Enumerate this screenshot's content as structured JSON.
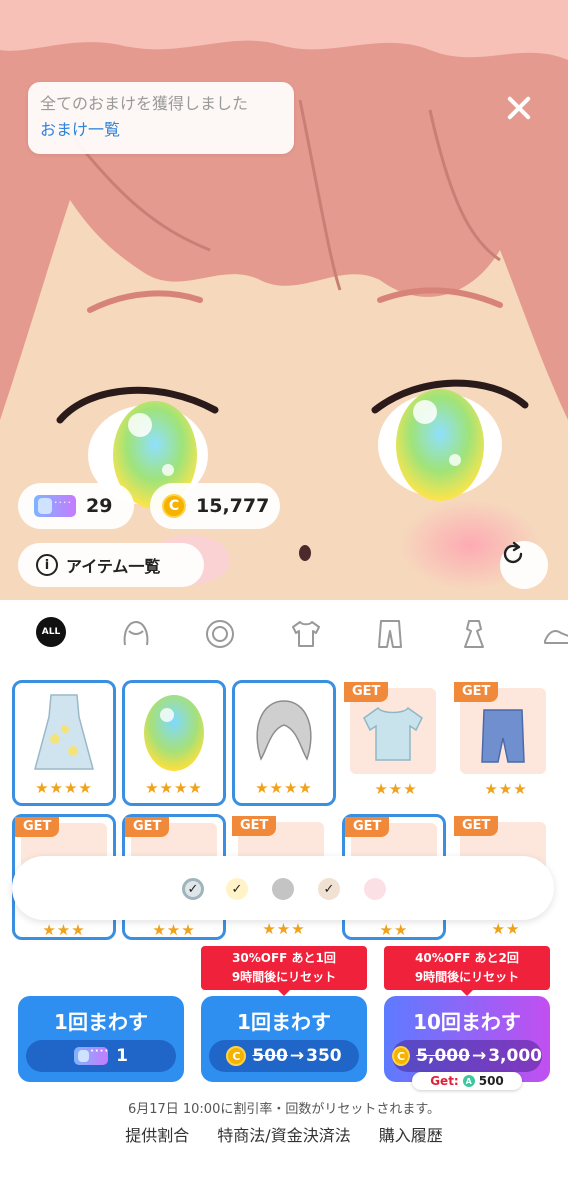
{
  "toast": {
    "message": "全てのおまけを獲得しました",
    "link": "おまけ一覧"
  },
  "balances": {
    "tickets": "29",
    "coins": "15,777"
  },
  "items_button": "アイテム一覧",
  "tab_all": "ALL",
  "grid": {
    "row1": [
      {
        "stars": "★★★★",
        "owned": true,
        "get": false
      },
      {
        "stars": "★★★★",
        "owned": true,
        "get": false
      },
      {
        "stars": "★★★★",
        "owned": true,
        "get": false
      },
      {
        "stars": "★★★",
        "owned": false,
        "get": true
      },
      {
        "stars": "★★★",
        "owned": false,
        "get": true
      }
    ],
    "row2": [
      {
        "stars": "★★★",
        "owned": true,
        "get": true
      },
      {
        "stars": "★★★",
        "owned": true,
        "get": true
      },
      {
        "stars": "★★★",
        "owned": false,
        "get": true
      },
      {
        "stars": "★★",
        "owned": true,
        "get": true
      },
      {
        "stars": "★★",
        "owned": false,
        "get": true
      }
    ],
    "get_label": "GET"
  },
  "colors": {
    "swatches": [
      "#dfe6ea",
      "#fff3c7",
      "#c4c4c4",
      "#f0e1d3",
      "#fbe0e6"
    ],
    "check": "✓"
  },
  "gacha": {
    "spin1": {
      "title": "1回まわす",
      "cost": "1"
    },
    "spin2": {
      "sale_line1": "30%OFF あと1回",
      "sale_line2": "9時間後にリセット",
      "title": "1回まわす",
      "old": "500",
      "arrow": "→",
      "new": "350"
    },
    "spin3": {
      "sale_line1": "40%OFF あと2回",
      "sale_line2": "9時間後にリセット",
      "title": "10回まわす",
      "old": "5,000",
      "arrow": "→",
      "new": "3,000",
      "bonus_label": "Get:",
      "bonus_amount": "500"
    }
  },
  "coin_symbol": "C",
  "reset_note": "6月17日 10:00に割引率・回数がリセットされます。",
  "footer_links": [
    "提供割合",
    "特商法/資金決済法",
    "購入履歴"
  ],
  "accent_colors": {
    "blue": "#2f8ff0",
    "sale_red": "#f0213b",
    "star": "#f0a21b"
  }
}
